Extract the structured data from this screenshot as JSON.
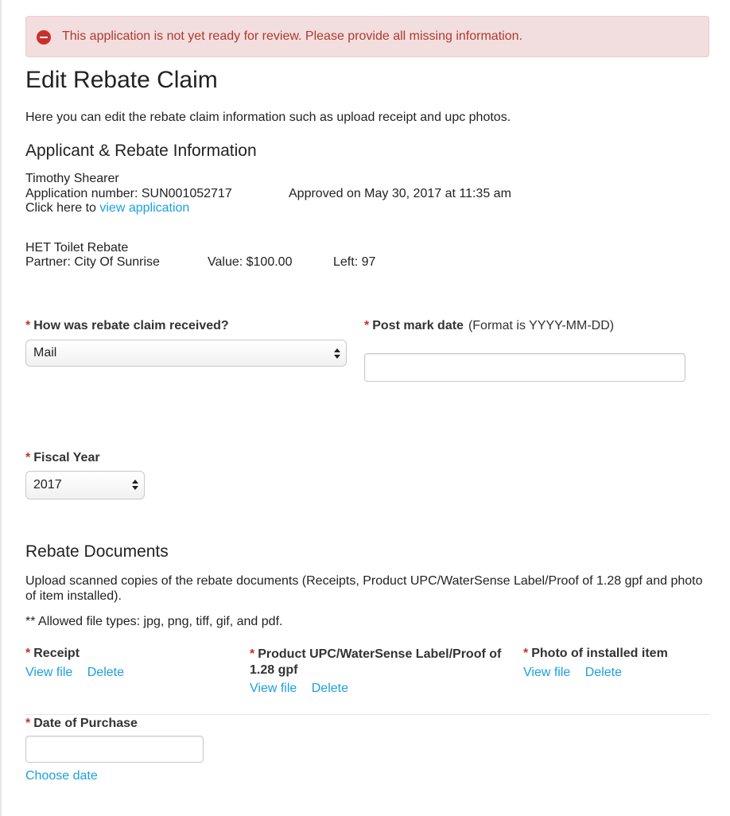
{
  "alert": {
    "message": "This application is not yet ready for review. Please provide all missing information.",
    "color": "#b0392f",
    "icon": "minus-circle-icon"
  },
  "page": {
    "title": "Edit Rebate Claim",
    "description": "Here you can edit the rebate claim information such as upload receipt and upc photos."
  },
  "applicant": {
    "heading": "Applicant & Rebate Information",
    "name": "Timothy Shearer",
    "application_number": "Application number: SUN001052717",
    "approved": "Approved on May 30, 2017 at 11:35 am",
    "click_prefix": "Click here to",
    "view_link": "view application"
  },
  "rebate": {
    "name": "HET Toilet Rebate",
    "partner": "Partner: City Of Sunrise",
    "value": "Value: $100.00",
    "left": "Left: 97"
  },
  "form": {
    "required_mark": "*",
    "received_label": "How was rebate claim received?",
    "received_value": "Mail",
    "postmark_label": "Post mark date",
    "postmark_hint": "(Format is YYYY-MM-DD)",
    "postmark_value": "",
    "fiscal_label": "Fiscal Year",
    "fiscal_value": "2017"
  },
  "documents": {
    "heading": "Rebate Documents",
    "description": "Upload scanned copies of the rebate documents (Receipts, Product UPC/WaterSense Label/Proof of 1.28 gpf and photo of item installed).",
    "allowed": "** Allowed file types: jpg, png, tiff, gif, and pdf.",
    "receipt_label": "Receipt",
    "upc_label": "Product UPC/WaterSense Label/Proof of 1.28 gpf",
    "photo_label": "Photo of installed item",
    "view_file": "View file",
    "delete": "Delete"
  },
  "purchase": {
    "label": "Date of Purchase",
    "value": "",
    "choose_date": "Choose date"
  },
  "colors": {
    "link": "#1aa0e0",
    "required": "#c9302c",
    "alert_bg": "#f2dede"
  }
}
